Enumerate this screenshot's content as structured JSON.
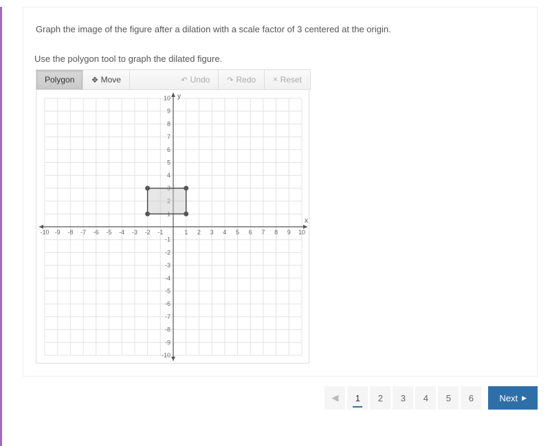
{
  "question": "Graph the image of the figure after a dilation with a scale factor of 3 centered at the origin.",
  "instruction": "Use the polygon tool to graph the dilated figure.",
  "toolbar": {
    "polygon": "Polygon",
    "move": "Move",
    "undo": "Undo",
    "redo": "Redo",
    "reset": "Reset"
  },
  "pagination": {
    "pages": [
      "1",
      "2",
      "3",
      "4",
      "5",
      "6"
    ],
    "current": "1",
    "next": "Next"
  },
  "chart_data": {
    "type": "coordinate-grid",
    "x_axis": {
      "min": -10,
      "max": 10,
      "step": 1,
      "label": "x"
    },
    "y_axis": {
      "min": -10,
      "max": 10,
      "step": 1,
      "label": "y"
    },
    "figure": {
      "shape": "rectangle",
      "vertices": [
        {
          "x": -2,
          "y": 1
        },
        {
          "x": 1,
          "y": 1
        },
        {
          "x": 1,
          "y": 3
        },
        {
          "x": -2,
          "y": 3
        }
      ]
    },
    "dilation": {
      "scale_factor": 3,
      "center": {
        "x": 0,
        "y": 0
      }
    }
  }
}
